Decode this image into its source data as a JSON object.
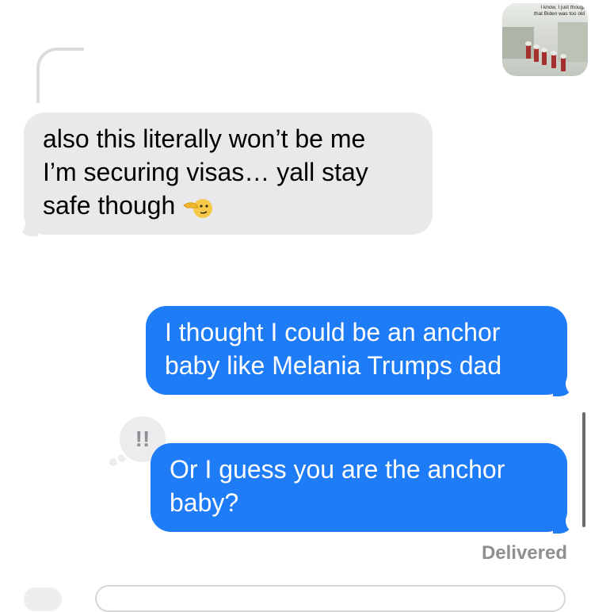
{
  "image_attachment": {
    "caption_line1": "I know, I just thougt",
    "caption_line2": "that Biden was too old"
  },
  "messages": [
    {
      "from": "them",
      "lines": [
        "also this literally won’t be me",
        "I’m securing visas… yall stay",
        "safe though"
      ],
      "emoji": "pointing-left-face-icon"
    },
    {
      "from": "me",
      "lines": [
        "I thought I could be an anchor",
        "baby like Melania Trumps dad"
      ]
    },
    {
      "from": "me",
      "lines": [
        "Or I guess you are the anchor",
        "baby?"
      ],
      "tapback": "!!"
    }
  ],
  "status": {
    "delivered": "Delivered"
  },
  "colors": {
    "sent_bubble": "#1f7cf7",
    "received_bubble": "#e9e9eb",
    "status_text": "#8e8e93"
  }
}
